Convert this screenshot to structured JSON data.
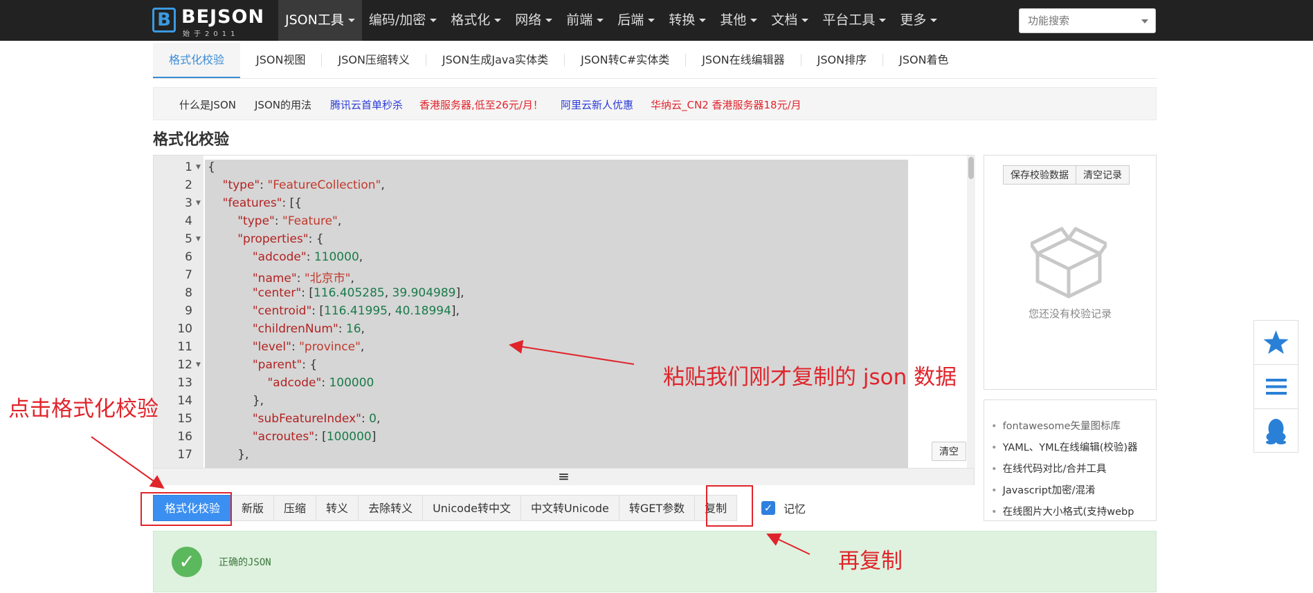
{
  "topbar": {
    "logo": {
      "letter": "B",
      "name": "BEJSON",
      "sub": "始于2011"
    },
    "nav": [
      {
        "label": "JSON工具",
        "active": true
      },
      {
        "label": "编码/加密"
      },
      {
        "label": "格式化"
      },
      {
        "label": "网络"
      },
      {
        "label": "前端"
      },
      {
        "label": "后端"
      },
      {
        "label": "转换"
      },
      {
        "label": "其他"
      },
      {
        "label": "文档"
      },
      {
        "label": "平台工具"
      },
      {
        "label": "更多"
      }
    ],
    "search_placeholder": "功能搜索"
  },
  "tabs": [
    "格式化校验",
    "JSON视图",
    "JSON压缩转义",
    "JSON生成Java实体类",
    "JSON转C#实体类",
    "JSON在线编辑器",
    "JSON排序",
    "JSON着色"
  ],
  "linkbar": [
    {
      "label": "什么是JSON",
      "color": "#333333"
    },
    {
      "label": "JSON的用法",
      "color": "#333333"
    },
    {
      "label": "腾讯云首单秒杀",
      "color": "#2b3ad8"
    },
    {
      "label": "香港服务器,低至26元/月！",
      "color": "#e0242b"
    },
    {
      "label": "阿里云新人优惠",
      "color": "#2b3ad8"
    },
    {
      "label": "华纳云_CN2 香港服务器18元/月",
      "color": "#e0242b"
    }
  ],
  "page_title": "格式化校验",
  "editor": {
    "line_numbers": [
      "1",
      "2",
      "3",
      "4",
      "5",
      "6",
      "7",
      "8",
      "9",
      "10",
      "11",
      "12",
      "13",
      "14",
      "15",
      "16",
      "17"
    ],
    "clear_label": "清空",
    "resize_glyph": "≡"
  },
  "toolbar": [
    "格式化校验",
    "新版",
    "压缩",
    "转义",
    "去除转义",
    "Unicode转中文",
    "中文转Unicode",
    "转GET参数",
    "复制"
  ],
  "memory": {
    "label": "记忆",
    "checked": true
  },
  "result": {
    "text": "正确的JSON",
    "status_color": "#5cb85c"
  },
  "record_panel": {
    "save_label": "保存校验数据",
    "clear_label": "清空记录",
    "empty_text": "您还没有校验记录"
  },
  "links_panel": [
    "fontawesome矢量图标库",
    "YAML、YML在线编辑(校验)器",
    "在线代码对比/合并工具",
    "Javascript加密/混淆",
    "在线图片大小格式(支持webp"
  ],
  "annotations": {
    "click_format": "点击格式化校验",
    "paste_json": "粘贴我们刚才复制的 json 数据",
    "copy_again": "再复制"
  },
  "colors": {
    "accent": "#3b8ff0",
    "annotation": "#e0242b",
    "topbar": "#222222"
  }
}
